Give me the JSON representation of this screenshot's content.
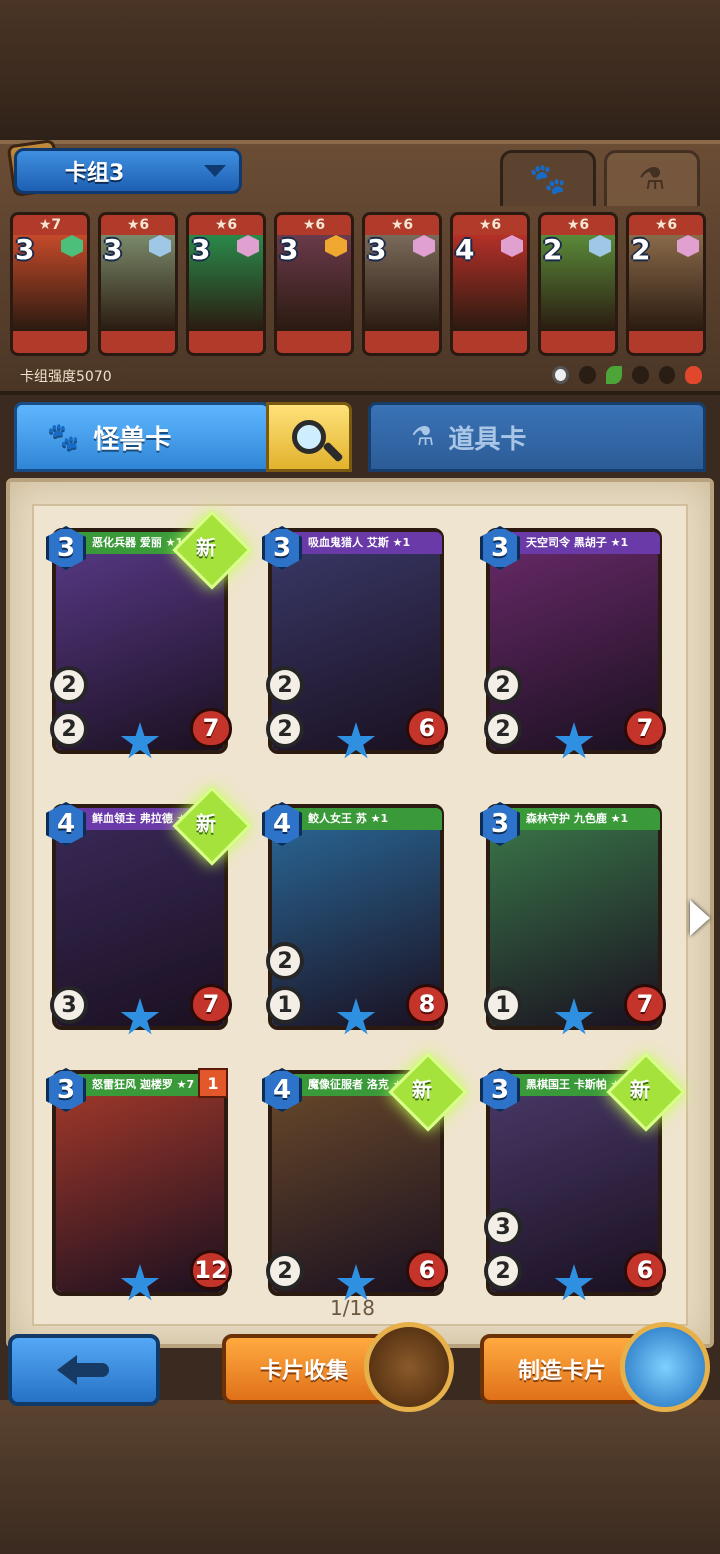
{
  "deck": {
    "name": "卡组3",
    "strength_label": "卡组强度5070",
    "cards": [
      {
        "stars": "★7",
        "cost": "3",
        "gem": "#4cc07a",
        "art": "#c54a2a"
      },
      {
        "stars": "★6",
        "cost": "3",
        "gem": "#9fc8e6",
        "art": "#7a8a6a"
      },
      {
        "stars": "★6",
        "cost": "3",
        "gem": "#e0a0d0",
        "art": "#2a8a4a"
      },
      {
        "stars": "★6",
        "cost": "3",
        "gem": "#f0a830",
        "art": "#6a3a4a"
      },
      {
        "stars": "★6",
        "cost": "3",
        "gem": "#e0a0d0",
        "art": "#7a6a5a"
      },
      {
        "stars": "★6",
        "cost": "4",
        "gem": "#e0a0d0",
        "art": "#b43028"
      },
      {
        "stars": "★6",
        "cost": "2",
        "gem": "#9fc8e6",
        "art": "#5a8a3a"
      },
      {
        "stars": "★6",
        "cost": "2",
        "gem": "#e0a0d0",
        "art": "#8a6a4a"
      }
    ]
  },
  "top_tabs": {
    "monster_icon": "paw-icon",
    "item_icon": "potion-icon"
  },
  "tabs": {
    "monster": "怪兽卡",
    "item": "道具卡"
  },
  "cards": [
    {
      "name": "恶化兵器 爱丽 ★1",
      "cost": "3",
      "atk": "2",
      "def": "2",
      "hp": "7",
      "new": "新",
      "bar": "#3a9a3a",
      "art": "#5a3a8a"
    },
    {
      "name": "吸血鬼猎人 艾斯 ★1",
      "cost": "3",
      "atk": "2",
      "def": "2",
      "hp": "6",
      "new": "",
      "bar": "#6a3aa8",
      "art": "#3a3a6a"
    },
    {
      "name": "天空司令 黑胡子 ★1",
      "cost": "3",
      "atk": "2",
      "def": "2",
      "hp": "7",
      "new": "",
      "bar": "#6a3aa8",
      "art": "#6a2a6a"
    },
    {
      "name": "鲜血领主 弗拉德 ★1",
      "cost": "4",
      "atk": "3",
      "def": "",
      "hp": "7",
      "new": "新",
      "bar": "#6a3aa8",
      "art": "#3a2a5a"
    },
    {
      "name": "鲛人女王 苏 ★1",
      "cost": "4",
      "atk": "1",
      "def": "2",
      "hp": "8",
      "new": "",
      "bar": "#3a9a3a",
      "art": "#2a6a9a"
    },
    {
      "name": "森林守护 九色鹿 ★1",
      "cost": "3",
      "atk": "1",
      "def": "",
      "hp": "7",
      "new": "",
      "bar": "#3a9a3a",
      "art": "#3a7a4a"
    },
    {
      "name": "怒雷狂风 迦楼罗 ★7",
      "cost": "3",
      "atk": "",
      "def": "",
      "hp": "12",
      "new": "",
      "flag": "1",
      "bar": "#3a9a3a",
      "art": "#a83a2a"
    },
    {
      "name": "魔像征服者 洛克 ★1",
      "cost": "4",
      "atk": "2",
      "def": "",
      "hp": "6",
      "new": "新",
      "bar": "#3a9a3a",
      "art": "#6a4a2a"
    },
    {
      "name": "黑棋国王 卡斯帕 ★1",
      "cost": "3",
      "atk": "2",
      "def": "3",
      "hp": "6",
      "new": "新",
      "bar": "#3a9a3a",
      "art": "#4a3a6a"
    }
  ],
  "pager": "1/18",
  "buttons": {
    "collect": "卡片收集",
    "craft": "制造卡片"
  },
  "colors": {
    "monster_tab": "#3f95e8",
    "search": "#f5cd4a",
    "item_tab": "#2f64a6",
    "orange": "#f18b27"
  }
}
